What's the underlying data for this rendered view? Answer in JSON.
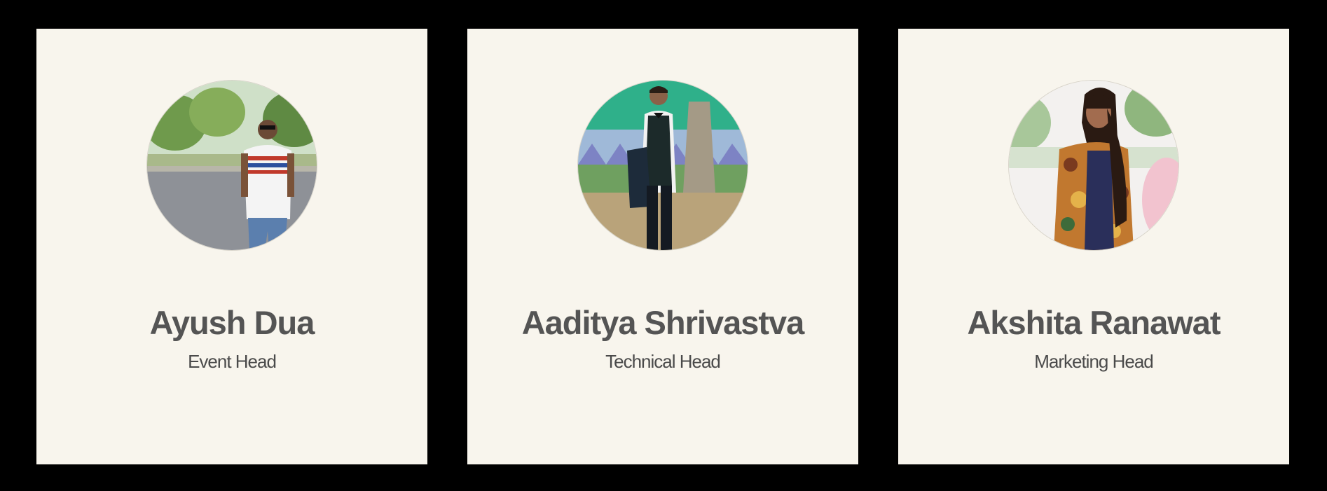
{
  "team": {
    "members": [
      {
        "name": "Ayush Dua",
        "role": "Event Head",
        "photo": "person-photo"
      },
      {
        "name": "Aaditya Shrivastva",
        "role": "Technical Head",
        "photo": "person-photo"
      },
      {
        "name": "Akshita Ranawat",
        "role": "Marketing Head",
        "photo": "person-photo"
      }
    ]
  },
  "colors": {
    "page_background": "#000000",
    "card_background": "#f8f5ed",
    "name_text": "#545454",
    "role_text": "#4a4a4a"
  }
}
